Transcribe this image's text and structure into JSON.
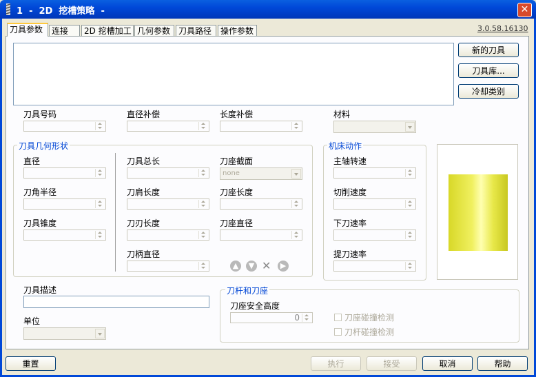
{
  "window": {
    "title": "1  -  2D  挖槽策略  -",
    "close_glyph": "✕"
  },
  "tabs": [
    "刀具参数",
    "连接",
    "2D 挖槽加工",
    "几何参数",
    "刀具路径",
    "操作参数"
  ],
  "version": "3.0.58.16130",
  "tool_buttons": {
    "new_tool": "新的刀具",
    "library": "刀具库...",
    "coolant": "冷却类别"
  },
  "fields": {
    "tool_number": "刀具号码",
    "diameter_comp": "直径补偿",
    "length_comp": "长度补偿",
    "material": "材料"
  },
  "geometry": {
    "title": "刀具几何形状",
    "diameter": "直径",
    "corner_radius": "刀角半径",
    "taper": "刀具锥度",
    "overall_length": "刀具总长",
    "shoulder_length": "刀肩长度",
    "flute_length": "刀刃长度",
    "shank_diameter": "刀柄直径",
    "holder_section": "刀座截面",
    "holder_section_value": "none",
    "holder_length": "刀座长度",
    "holder_diameter": "刀座直径"
  },
  "machine": {
    "title": "机床动作",
    "spindle_speed": "主轴转速",
    "cutting_speed": "切削速度",
    "plunge_rate": "下刀速率",
    "retract_rate": "提刀速率"
  },
  "icons": [
    "arrow-up-icon",
    "arrow-down-icon",
    "delete-icon",
    "arrow-right-icon"
  ],
  "description": {
    "label": "刀具描述",
    "unit_label": "单位"
  },
  "holder_group": {
    "title": "刀杆和刀座",
    "safe_height_label": "刀座安全高度",
    "safe_height_value": "0",
    "holder_collision": "刀座碰撞检测",
    "shank_collision": "刀杆碰撞检测"
  },
  "footer": {
    "reset": "重置",
    "execute": "执行",
    "accept": "接受",
    "cancel": "取消",
    "help": "帮助"
  }
}
